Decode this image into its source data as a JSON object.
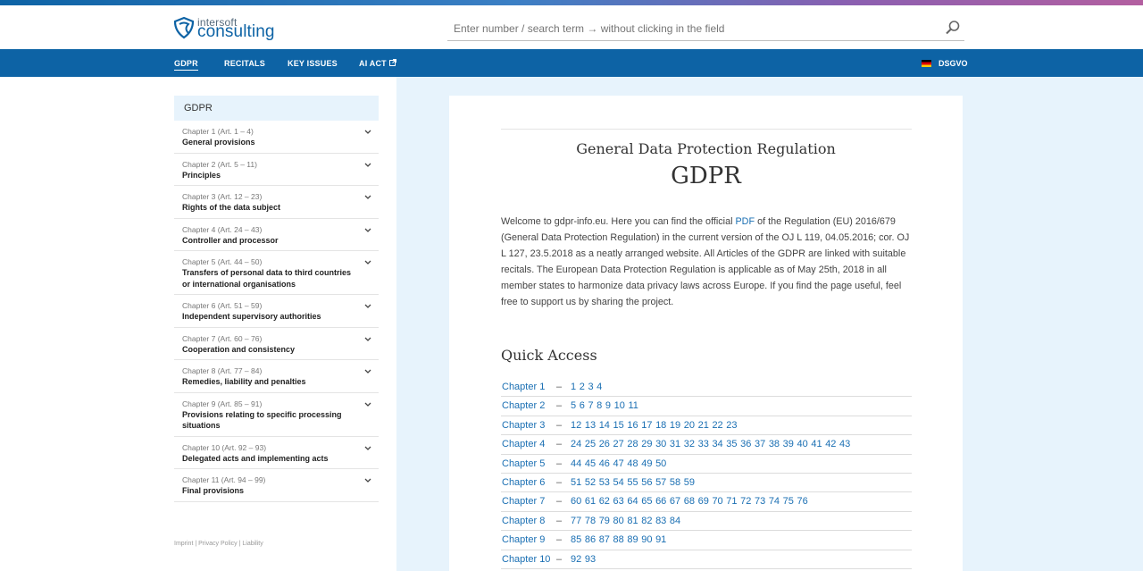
{
  "brand": {
    "line1": "intersoft",
    "line2": "consulting"
  },
  "search": {
    "placeholder": "Enter number / search term → without clicking in the field",
    "icon": "search-icon"
  },
  "nav": {
    "items": [
      "GDPR",
      "RECITALS",
      "KEY ISSUES",
      "AI ACT"
    ],
    "active": "GDPR",
    "language": "DSGVO"
  },
  "sidebar": {
    "heading": "GDPR",
    "chapters": [
      {
        "num": "Chapter 1 (Art. 1 – 4)",
        "title": "General provisions"
      },
      {
        "num": "Chapter 2 (Art. 5 – 11)",
        "title": "Principles"
      },
      {
        "num": "Chapter 3 (Art. 12 – 23)",
        "title": "Rights of the data subject"
      },
      {
        "num": "Chapter 4 (Art. 24 – 43)",
        "title": "Controller and processor"
      },
      {
        "num": "Chapter 5 (Art. 44 – 50)",
        "title": "Transfers of personal data to third countries or international organisations"
      },
      {
        "num": "Chapter 6 (Art. 51 – 59)",
        "title": "Independent supervisory authorities"
      },
      {
        "num": "Chapter 7 (Art. 60 – 76)",
        "title": "Cooperation and consistency"
      },
      {
        "num": "Chapter 8 (Art. 77 – 84)",
        "title": "Remedies, liability and penalties"
      },
      {
        "num": "Chapter 9 (Art. 85 – 91)",
        "title": "Provisions relating to specific processing situations"
      },
      {
        "num": "Chapter 10 (Art. 92 – 93)",
        "title": "Delegated acts and implementing acts"
      },
      {
        "num": "Chapter 11 (Art. 94 – 99)",
        "title": "Final provisions"
      }
    ],
    "footer": "Imprint | Privacy Policy | Liability"
  },
  "main": {
    "subtitle": "General Data Protection Regulation",
    "title": "GDPR",
    "intro_before_link": "Welcome to gdpr-info.eu. Here you can find the official ",
    "intro_link": "PDF",
    "intro_after_link": " of the Regulation (EU) 2016/679 (General Data Protection Regulation) in the current version of the OJ L 119, 04.05.2016; cor. OJ L 127, 23.5.2018 as a neatly arranged website. All Articles of the GDPR are linked with suitable recitals. The European Data Protection Regulation is applicable as of May 25th, 2018 in all member states to harmonize data privacy laws across Europe. If you find the page useful, feel free to support us by sharing the project.",
    "quick_access_title": "Quick Access",
    "quick_access": [
      {
        "chapter": "Chapter 1",
        "articles": [
          "1",
          "2",
          "3",
          "4"
        ]
      },
      {
        "chapter": "Chapter 2",
        "articles": [
          "5",
          "6",
          "7",
          "8",
          "9",
          "10",
          "11"
        ]
      },
      {
        "chapter": "Chapter 3",
        "articles": [
          "12",
          "13",
          "14",
          "15",
          "16",
          "17",
          "18",
          "19",
          "20",
          "21",
          "22",
          "23"
        ]
      },
      {
        "chapter": "Chapter 4",
        "articles": [
          "24",
          "25",
          "26",
          "27",
          "28",
          "29",
          "30",
          "31",
          "32",
          "33",
          "34",
          "35",
          "36",
          "37",
          "38",
          "39",
          "40",
          "41",
          "42",
          "43"
        ]
      },
      {
        "chapter": "Chapter 5",
        "articles": [
          "44",
          "45",
          "46",
          "47",
          "48",
          "49",
          "50"
        ]
      },
      {
        "chapter": "Chapter 6",
        "articles": [
          "51",
          "52",
          "53",
          "54",
          "55",
          "56",
          "57",
          "58",
          "59"
        ]
      },
      {
        "chapter": "Chapter 7",
        "articles": [
          "60",
          "61",
          "62",
          "63",
          "64",
          "65",
          "66",
          "67",
          "68",
          "69",
          "70",
          "71",
          "72",
          "73",
          "74",
          "75",
          "76"
        ]
      },
      {
        "chapter": "Chapter 8",
        "articles": [
          "77",
          "78",
          "79",
          "80",
          "81",
          "82",
          "83",
          "84"
        ]
      },
      {
        "chapter": "Chapter 9",
        "articles": [
          "85",
          "86",
          "87",
          "88",
          "89",
          "90",
          "91"
        ]
      },
      {
        "chapter": "Chapter 10",
        "articles": [
          "92",
          "93"
        ]
      }
    ],
    "dash": "–"
  },
  "colors": {
    "primary": "#0d63a5",
    "light_bg": "#e7f3fc",
    "link": "#1a6fb3"
  }
}
